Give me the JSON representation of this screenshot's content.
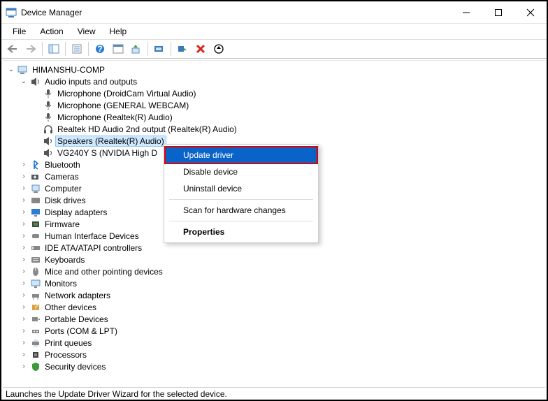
{
  "title": "Device Manager",
  "menus": {
    "file": "File",
    "action": "Action",
    "view": "View",
    "help": "Help"
  },
  "root": "HIMANSHU-COMP",
  "audio_category": "Audio inputs and outputs",
  "audio_children": [
    "Microphone (DroidCam Virtual Audio)",
    "Microphone (GENERAL WEBCAM)",
    "Microphone (Realtek(R) Audio)",
    "Realtek HD Audio 2nd output (Realtek(R) Audio)",
    "Speakers (Realtek(R) Audio)",
    "VG240Y S (NVIDIA High D"
  ],
  "categories": [
    "Bluetooth",
    "Cameras",
    "Computer",
    "Disk drives",
    "Display adapters",
    "Firmware",
    "Human Interface Devices",
    "IDE ATA/ATAPI controllers",
    "Keyboards",
    "Mice and other pointing devices",
    "Monitors",
    "Network adapters",
    "Other devices",
    "Portable Devices",
    "Ports (COM & LPT)",
    "Print queues",
    "Processors",
    "Security devices"
  ],
  "ctx": {
    "update": "Update driver",
    "disable": "Disable device",
    "uninstall": "Uninstall device",
    "scan": "Scan for hardware changes",
    "properties": "Properties"
  },
  "status": "Launches the Update Driver Wizard for the selected device."
}
